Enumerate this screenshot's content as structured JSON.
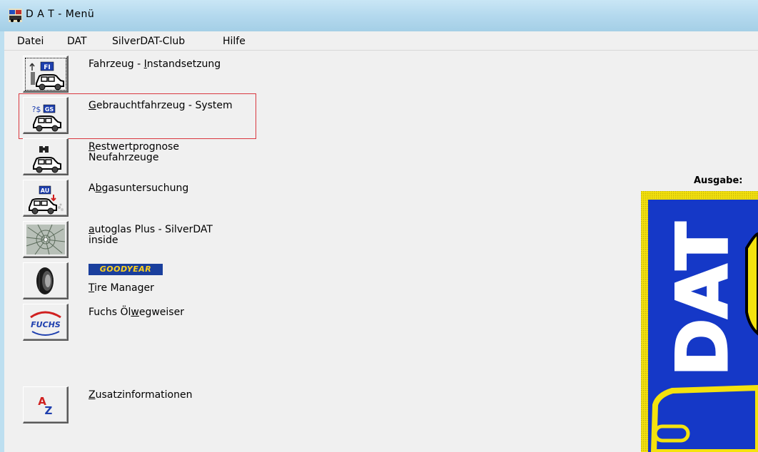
{
  "window": {
    "title": "D A T - Menü"
  },
  "menubar": {
    "items": [
      "Datei",
      "DAT",
      "SilverDAT-Club",
      "Hilfe"
    ]
  },
  "modules": [
    {
      "label_pre": "Fahrzeug -  ",
      "label_ul": "I",
      "label_post": "nstandsetzung",
      "line2": ""
    },
    {
      "label_pre": "",
      "label_ul": "G",
      "label_post": "ebrauchtfahrzeug - System",
      "line2": ""
    },
    {
      "label_pre": "",
      "label_ul": "R",
      "label_post": "estwertprognose",
      "line2": "Neufahrzeuge"
    },
    {
      "label_pre": "A",
      "label_ul": "b",
      "label_post": "gasuntersuchung",
      "line2": ""
    },
    {
      "label_pre": "",
      "label_ul": "a",
      "label_post": "utoglas Plus - SilverDAT",
      "line2": "inside"
    },
    {
      "label_pre": "",
      "label_ul": "T",
      "label_post": "ire Manager",
      "line2": ""
    },
    {
      "label_pre": "Fuchs Öl",
      "label_ul": "w",
      "label_post": "egweiser",
      "line2": ""
    },
    {
      "label_pre": "",
      "label_ul": "Z",
      "label_post": "usatzinformationen",
      "line2": ""
    }
  ],
  "icons": {
    "fi": "FI",
    "gs": "GS",
    "gs_prefix": "?$",
    "au": "AU",
    "fuchs": "FUCHS",
    "az_a": "A",
    "az_z": "Z"
  },
  "goodyear_logo": "GOODYEAR",
  "output": {
    "label": "Ausgabe:"
  },
  "dat_logo": {
    "text": "DAT"
  },
  "colors": {
    "highlight": "#d9373f",
    "logo_blue": "#1538c7",
    "logo_yellow": "#f4e20e"
  }
}
